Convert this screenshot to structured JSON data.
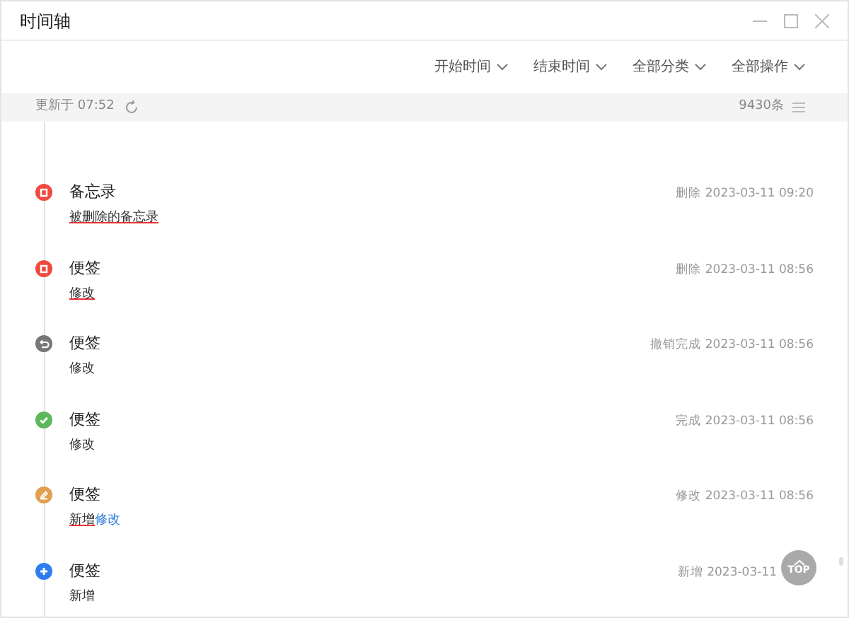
{
  "window": {
    "title": "时间轴"
  },
  "filters": [
    "开始时间",
    "结束时间",
    "全部分类",
    "全部操作"
  ],
  "status_bar": {
    "updated": "更新于 07:52",
    "count": "9430条"
  },
  "entries": [
    {
      "kind": "delete",
      "title": "备忘录",
      "action": "删除",
      "time": "2023-03-11 09:20",
      "content": [
        {
          "kind": "deleted",
          "text": "被删除的备忘录"
        }
      ]
    },
    {
      "kind": "delete",
      "title": "便签",
      "action": "删除",
      "time": "2023-03-11 08:56",
      "content": [
        {
          "kind": "deleted",
          "text": "修改"
        }
      ]
    },
    {
      "kind": "undo",
      "title": "便签",
      "action": "撤销完成",
      "time": "2023-03-11 08:56",
      "content": [
        {
          "kind": "plain",
          "text": "修改"
        }
      ]
    },
    {
      "kind": "done",
      "title": "便签",
      "action": "完成",
      "time": "2023-03-11 08:56",
      "content": [
        {
          "kind": "plain",
          "text": "修改"
        }
      ]
    },
    {
      "kind": "edit",
      "title": "便签",
      "action": "修改",
      "time": "2023-03-11 08:56",
      "content": [
        {
          "kind": "deleted",
          "text": "新增"
        },
        {
          "kind": "added",
          "text": "修改"
        }
      ]
    },
    {
      "kind": "add",
      "title": "便签",
      "action": "新增",
      "time": "2023-03-11",
      "content": [
        {
          "kind": "plain",
          "text": "新增"
        }
      ]
    }
  ],
  "top_button": {
    "label": "TOP"
  }
}
